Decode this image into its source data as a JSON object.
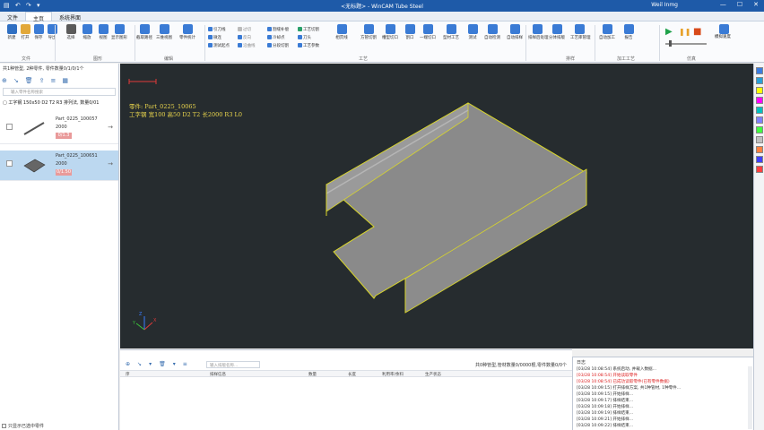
{
  "titlebar": {
    "quick_access": "▤ ↶ ↷ ▾",
    "title": "<无标题> - WinCAM Tube Steel",
    "user": "Weil Inmg",
    "min": "—",
    "max": "☐",
    "close": "✕"
  },
  "menu": [
    "文件",
    "主页",
    "系统界面"
  ],
  "ribbon": {
    "buttons": [
      {
        "label": "新建",
        "color": "#2f6fc2"
      },
      {
        "label": "打开",
        "color": "#e2a83a"
      },
      {
        "label": "保存",
        "color": "#3a7bd5"
      },
      {
        "label": "导出",
        "color": "#3a7bd5"
      },
      {
        "label": "选择",
        "color": "#5a5a5a"
      },
      {
        "label": "缩放",
        "color": "#3a7bd5"
      },
      {
        "label": "视图",
        "color": "#3a7bd5"
      },
      {
        "label": "显示图形",
        "color": "#3a7bd5"
      },
      {
        "label": "截取路径",
        "color": "#3a7bd5"
      },
      {
        "label": "三维视图",
        "color": "#3a7bd5"
      },
      {
        "label": "零件统计",
        "color": "#3a7bd5"
      }
    ],
    "small_col1": [
      "引刀线",
      "微连",
      "测试起点"
    ],
    "small_col2": [
      "过切",
      "反向",
      "沿曲线"
    ],
    "small_col3": [
      "割缝补偿",
      "冷却点",
      "分段切割"
    ],
    "small_col4": [
      "工艺切割",
      "刀头",
      "工艺参数"
    ],
    "buttons2": [
      {
        "label": "相贯线",
        "color": "#3a7bd5"
      },
      {
        "label": "方管切割",
        "color": "#3a7bd5"
      },
      {
        "label": "槽型切口",
        "color": "#3a7bd5"
      },
      {
        "label": "割口",
        "color": "#3a7bd5"
      },
      {
        "label": "一端切口",
        "color": "#3a7bd5"
      },
      {
        "label": "型材工艺",
        "color": "#3a7bd5"
      },
      {
        "label": "测试",
        "color": "#3a7bd5"
      },
      {
        "label": "自动检测",
        "color": "#3a7bd5"
      },
      {
        "label": "自动排样",
        "color": "#3a7bd5"
      },
      {
        "label": "排样后处理",
        "color": "#3a7bd5"
      },
      {
        "label": "分体排版",
        "color": "#3a7bd5"
      },
      {
        "label": "工艺库管理",
        "color": "#3a7bd5"
      },
      {
        "label": "自动加工",
        "color": "#3a7bd5"
      },
      {
        "label": "报告",
        "color": "#3a7bd5"
      }
    ],
    "sim_labels": {
      "play": "▶",
      "pause": "❚❚",
      "stop": "■",
      "speed": "模拟速度"
    },
    "groups": [
      "文件",
      "图形",
      "编辑",
      "工艺",
      "排样",
      "加工工艺",
      "仿真"
    ]
  },
  "leftpanel": {
    "summary": "共1种管型, 2种零件, 零件数量0/1/0/1个",
    "tools": [
      "⊕",
      "↘",
      "🗑",
      "⇪",
      "≡",
      "▦"
    ],
    "search_placeholder": "输入零件名称搜索",
    "stock": "▢ 工字钢 150x50 D2 T2 R3  排列法, 数量0/01",
    "parts": [
      {
        "name": "Part_0225_100057",
        "length": "2000",
        "qty": "0/1.3"
      },
      {
        "name": "Part_0225_100651",
        "length": "2000",
        "qty": "0/1.50"
      }
    ],
    "arrow": "→",
    "bottom_option": "只显示已选中零件"
  },
  "viewport": {
    "info_line1": "零件: Part_0225_10065",
    "info_line2": "工字钢 宽100 高50 D2 T2 长2000 R3 L0",
    "axis_x": "X",
    "axis_y": "Y",
    "axis_z": "Z"
  },
  "bottompanel": {
    "tools": [
      "⊕",
      "↘",
      "▾",
      "🗑",
      "▾",
      "≡"
    ],
    "search_placeholder": "输入排版名称...",
    "stats": "共0种管型,管材数量0/0000根,零件数量0/0个",
    "columns": [
      "序",
      "排样信息",
      "数量",
      "长度",
      "利用率/余料",
      "生产状态"
    ]
  },
  "log": {
    "title": "日志",
    "lines": [
      {
        "text": "[03/28 10:08:54] 系统启动, 并载入数据...",
        "red": false
      },
      {
        "text": "[03/28 10:08:54] 开始读取零件",
        "red": true
      },
      {
        "text": "[03/28 10:08:54] 已成功读取零件(已有零件数据)",
        "red": true
      },
      {
        "text": "[03/28 10:09:15] 打开排样方案, 共1种管材, 1种零件...",
        "red": false
      },
      {
        "text": "[03/28 10:09:15] 开始排样...",
        "red": false
      },
      {
        "text": "[03/28 10:09:17] 排样结束...",
        "red": false
      },
      {
        "text": "[03/28 10:09:18] 开始排样...",
        "red": false
      },
      {
        "text": "[03/28 10:09:19] 排样结束...",
        "red": false
      },
      {
        "text": "[03/28 10:09:21] 开始排样...",
        "red": false
      },
      {
        "text": "[03/28 10:09:22] 排样结束...",
        "red": false
      }
    ]
  },
  "right_swatches": [
    "#3b7de0",
    "#2aa0d8",
    "#ffff00",
    "#ff00ff",
    "#00c0c0",
    "#8080ff",
    "#40ff40",
    "#c0c0c0",
    "#ff8040",
    "#4040ff",
    "#ff4040"
  ]
}
